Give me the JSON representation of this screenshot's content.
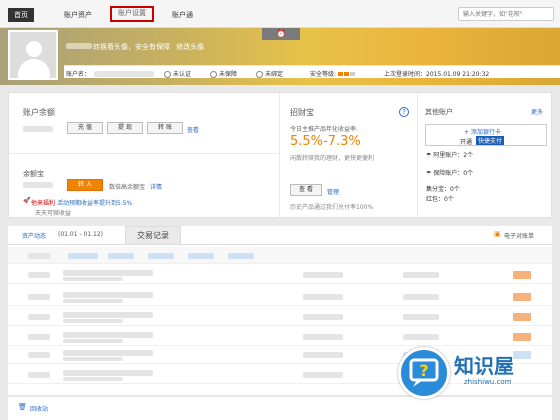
{
  "nav": {
    "home": "首页",
    "assets": "账户资产",
    "settings": "账户设置",
    "alipay_tong": "账户通",
    "search_placeholder": "输入关键字，如\"花呗\""
  },
  "banner": {
    "tab_icon": "alarm-clock-icon",
    "tagline": "转换看头像，安全有保障",
    "edit_avatar": "修改头像",
    "account_label": "账户名：",
    "verify": "未认证",
    "protect": "未保障",
    "bind": "未绑定",
    "security_label": "安全等级:",
    "last_login_label": "上次登录时间：",
    "last_login_time": "2015.01.09 21:20:32"
  },
  "balance": {
    "title": "账户余额",
    "recharge": "充 值",
    "withdraw": "提 现",
    "transfer": "转 账",
    "view": "查看"
  },
  "yuebao": {
    "title": "余额宝",
    "transfer_in": "转 入",
    "income_note": "数倍高余额宝",
    "details": "详情",
    "promo_label": "他来福利",
    "promo_text": "活动预期收益率提升到5.5%",
    "promo_sub": "天天可赎收益"
  },
  "zhaocaibao": {
    "title": "招财宝",
    "subtitle": "今日主推产品年化收益率:",
    "rate": "5.5%-7.3%",
    "desc": "闲散转赎我的理财，更快更便利",
    "view": "查 看",
    "manage": "管理",
    "history": "历史产品通过我们兑付率100%"
  },
  "other": {
    "title": "其他账户",
    "more": "更多",
    "add_card": "+ 添加银行卡",
    "open": "开通",
    "quick_pay": "快捷支付",
    "alitrip": "阿里账户：2个",
    "insurance": "保险账户：0个",
    "jifenbao": "集分宝：0个",
    "hongbao": "红包：0个"
  },
  "tabs": {
    "assets_activity": "资产动态",
    "date_range": "(01.01 - 01.12)",
    "trade_records": "交易记录",
    "e_statement": "电子对账单"
  },
  "footer": {
    "recycle": "回收站"
  },
  "watermark": {
    "brand": "知识屋",
    "domain": "zhishiwu.com"
  },
  "colors": {
    "accent": "#f08300",
    "link": "#2a6ac0",
    "highlight_border": "#cc0000"
  }
}
